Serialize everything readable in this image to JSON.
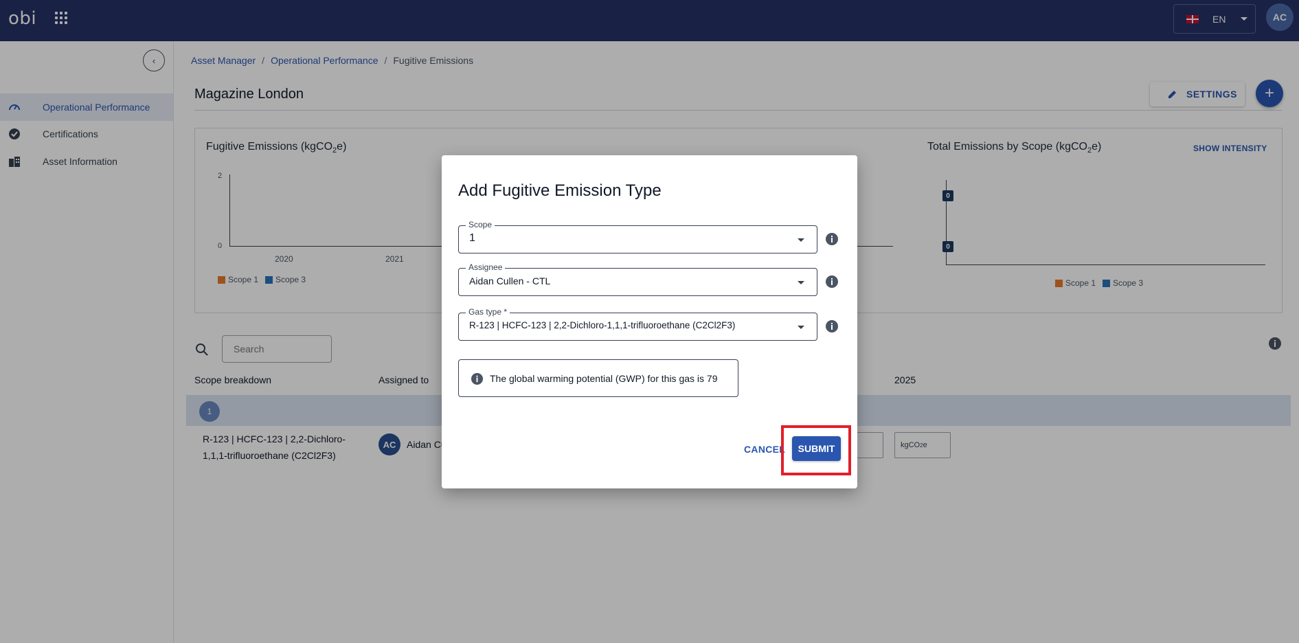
{
  "topbar": {
    "logo": "obi",
    "language": "EN",
    "user_initials": "AC"
  },
  "sidebar": {
    "items": [
      {
        "label": "Operational Performance",
        "icon": "speedometer-icon",
        "active": true
      },
      {
        "label": "Certifications",
        "icon": "badge-check-icon",
        "active": false
      },
      {
        "label": "Asset Information",
        "icon": "buildings-icon",
        "active": false
      }
    ]
  },
  "breadcrumb": {
    "items": [
      "Asset Manager",
      "Operational Performance",
      "Fugitive Emissions"
    ],
    "separator": "/"
  },
  "page": {
    "title": "Magazine London",
    "settings_label": "SETTINGS",
    "add_label": "+"
  },
  "charts": {
    "left_title_main": "Fugitive Emissions (kgCO",
    "left_title_sub": "2",
    "left_title_end": "e)",
    "right_title_main": "Total Emissions by Scope (kgCO",
    "right_title_sub": "2",
    "right_title_end": "e)",
    "show_intensity": "SHOW INTENSITY",
    "legend_scope1": "Scope 1",
    "legend_scope3": "Scope 3"
  },
  "chart_data": [
    {
      "type": "bar",
      "title": "Fugitive Emissions (kgCO2e)",
      "categories": [
        "2020",
        "2021"
      ],
      "series": [
        {
          "name": "Scope 1",
          "values": [
            0,
            0
          ]
        },
        {
          "name": "Scope 3",
          "values": [
            0,
            0
          ]
        }
      ],
      "yticks": [
        "2",
        "0"
      ],
      "ylim": [
        0,
        2
      ],
      "legend": "bottom-left",
      "colors": {
        "Scope 1": "#e8792b",
        "Scope 3": "#2a74b8"
      }
    },
    {
      "type": "bar",
      "title": "Total Emissions by Scope (kgCO2e)",
      "categories": [
        "Scope 1",
        "Scope 3"
      ],
      "values": [
        0,
        0
      ],
      "data_labels": [
        "0",
        "0"
      ],
      "legend": "bottom",
      "colors": {
        "Scope 1": "#e8792b",
        "Scope 3": "#2a74b8"
      }
    }
  ],
  "table": {
    "search_placeholder": "Search",
    "headers": {
      "scope": "Scope breakdown",
      "assigned": "Assigned to",
      "year": "2025"
    },
    "group_label": "1",
    "row": {
      "gas": "R-123 | HCFC-123 | 2,2-Dichloro-1,1,1-trifluoroethane (C2Cl2F3)",
      "assignee_initials": "AC",
      "assignee_name": "Aidan Cu",
      "unit_partial": "e",
      "unit_main": "kgCO",
      "unit_sub": "2",
      "unit_end": "e"
    }
  },
  "dialog": {
    "title": "Add Fugitive Emission Type",
    "scope": {
      "label": "Scope",
      "value": "1"
    },
    "assignee": {
      "label": "Assignee",
      "value": "Aidan Cullen - CTL"
    },
    "gas_type": {
      "label": "Gas type *",
      "value": "R-123 | HCFC-123 | 2,2-Dichloro-1,1,1-trifluoroethane (C2Cl2F3)"
    },
    "gwp_text": "The global warming potential (GWP) for this gas is 79",
    "cancel_label": "CANCEL",
    "submit_label": "SUBMIT"
  },
  "colors": {
    "topbar": "#263266",
    "accent": "#2a56b0",
    "scope1": "#e8792b",
    "scope3": "#2a74b8",
    "highlight": "#e0202a"
  }
}
